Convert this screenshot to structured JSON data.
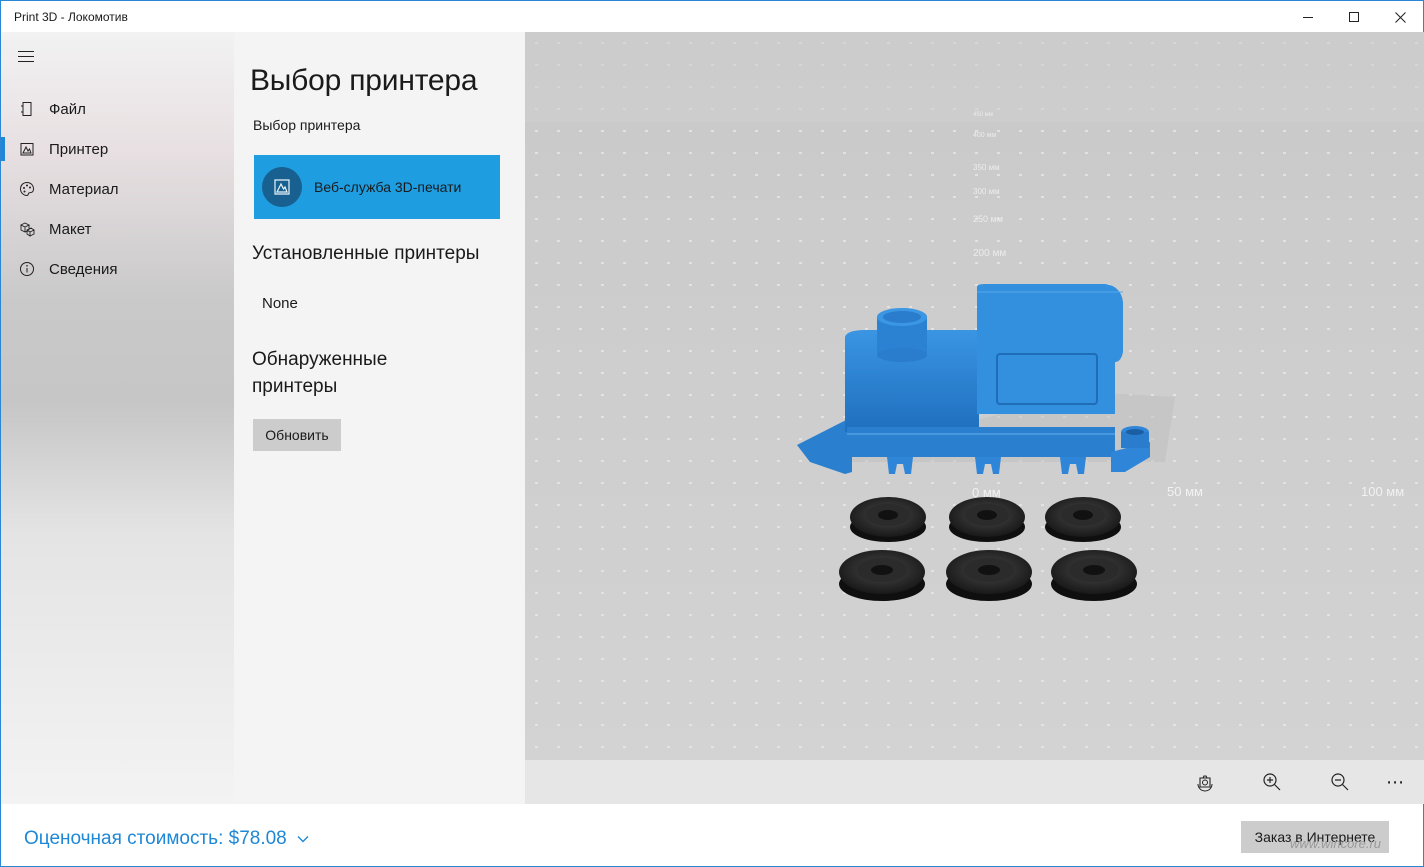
{
  "window": {
    "title": "Print 3D - Локомотив",
    "minimize": "minimize",
    "maximize": "maximize",
    "close": "close"
  },
  "nav": {
    "items": [
      {
        "label": "Файл",
        "icon": "file-icon"
      },
      {
        "label": "Принтер",
        "icon": "printer-icon",
        "active": true
      },
      {
        "label": "Материал",
        "icon": "palette-icon"
      },
      {
        "label": "Макет",
        "icon": "layout-icon"
      },
      {
        "label": "Сведения",
        "icon": "info-icon"
      }
    ]
  },
  "panel": {
    "title": "Выбор принтера",
    "subtitle": "Выбор принтера",
    "web_service": "Веб-служба 3D-печати",
    "installed_heading": "Установленные принтеры",
    "installed_value": "None",
    "discovered_heading_1": "Обнаруженные",
    "discovered_heading_2": "принтеры",
    "refresh_label": "Обновить"
  },
  "viewport": {
    "ruler_labels": [
      "200 мм",
      "250 мм",
      "300 мм",
      "350 мм",
      "400 мм",
      "450 мм"
    ],
    "axis_labels": [
      "0 мм",
      "50 мм",
      "100 мм"
    ],
    "model_color": "#2f86d8"
  },
  "toolbar": {
    "icons": [
      "reset-view-icon",
      "zoom-in-icon",
      "zoom-out-icon",
      "more-icon"
    ],
    "more_label": "⋯"
  },
  "footer": {
    "cost_label": "Оценочная стоимость: $78.08",
    "order_label": "Заказ в Интернете"
  },
  "watermark": "www.wincore.ru",
  "colors": {
    "accent": "#1e88d6",
    "web_service_bg": "#1e9de1"
  }
}
